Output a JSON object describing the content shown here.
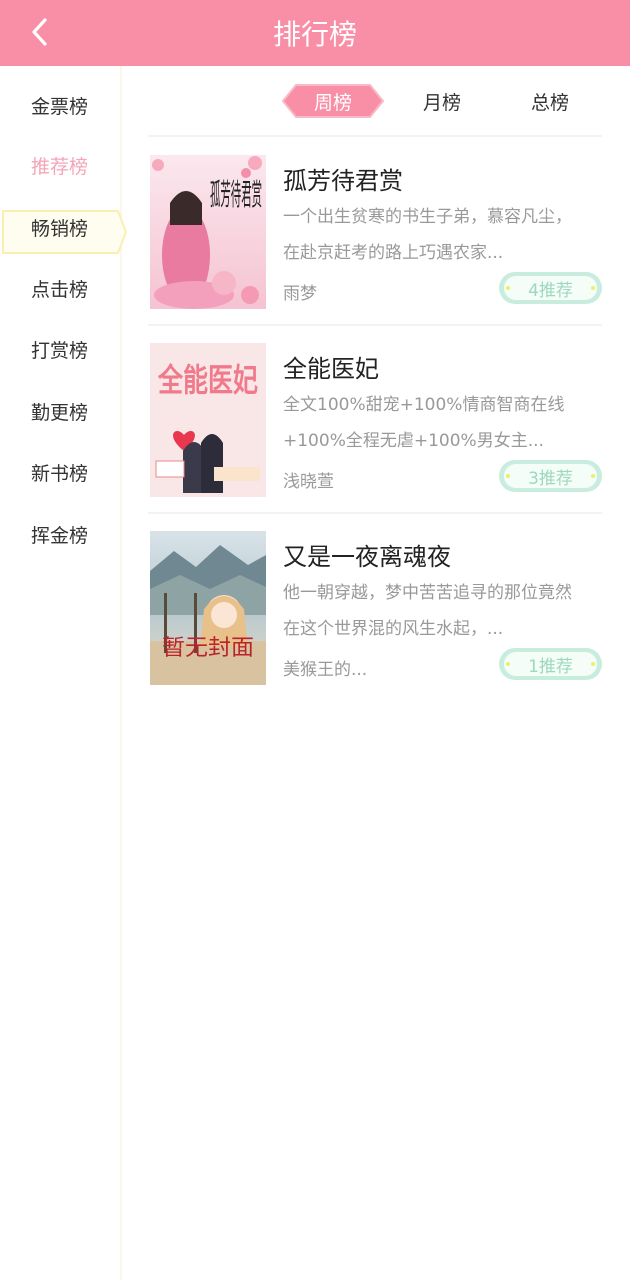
{
  "header": {
    "title": "排行榜",
    "back_icon": "chevron-left-icon"
  },
  "sidebar": {
    "items": [
      {
        "label": "金票榜",
        "active": false
      },
      {
        "label": "推荐榜",
        "active": true
      },
      {
        "label": "畅销榜",
        "active": false
      },
      {
        "label": "点击榜",
        "active": false
      },
      {
        "label": "打赏榜",
        "active": false
      },
      {
        "label": "勤更榜",
        "active": false
      },
      {
        "label": "新书榜",
        "active": false
      },
      {
        "label": "挥金榜",
        "active": false
      }
    ]
  },
  "tabs": [
    {
      "label": "周榜",
      "active": true
    },
    {
      "label": "月榜",
      "active": false
    },
    {
      "label": "总榜",
      "active": false
    }
  ],
  "books": [
    {
      "title": "孤芳待君赏",
      "desc": "一个出生贫寒的书生子弟，慕容凡尘，在赴京赶考的路上巧遇农家...",
      "author": "雨梦",
      "rec": "4推荐"
    },
    {
      "title": "全能医妃",
      "desc": "全文100%甜宠+100%情商智商在线+100%全程无虐+100%男女主...",
      "author": "浅晓萱",
      "rec": "3推荐"
    },
    {
      "title": "又是一夜离魂夜",
      "desc": "他一朝穿越，梦中苦苦追寻的那位竟然在这个世界混的风生水起，...",
      "author": "美猴王的...",
      "rec": "1推荐"
    }
  ],
  "covers": [
    {
      "text": "孤芳待君赏"
    },
    {
      "text": "全能医妃"
    },
    {
      "text": "暂无封面"
    }
  ],
  "colors": {
    "header": "#f98fa6",
    "active_pink": "#f5a4b9",
    "badge_green": "#9dd8bf"
  }
}
